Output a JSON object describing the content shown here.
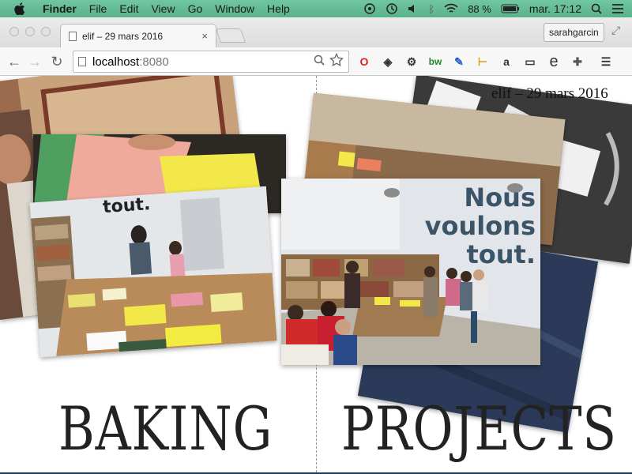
{
  "menubar": {
    "app_name": "Finder",
    "items": [
      "File",
      "Edit",
      "View",
      "Go",
      "Window",
      "Help"
    ],
    "battery": "88 %",
    "clock": "mar. 17:12"
  },
  "browser": {
    "tab_title": "elif – 29 mars 2016",
    "tab_close": "×",
    "profile_name": "sarahgarcin",
    "url_host": "localhost",
    "url_port": ":8080",
    "back_glyph": "←",
    "forward_glyph": "→",
    "reload_glyph": "↻",
    "menu_glyph": "☰",
    "extensions": [
      "O",
      "◈",
      "⚙",
      "bw",
      "✎",
      "⊢",
      "a",
      "▭",
      "e",
      "✚"
    ]
  },
  "page": {
    "doc_title": "elif – 29 mars 2016",
    "word_left": "BAKING",
    "word_right": "PROJECTS",
    "wall_sign": [
      "Nous",
      "voulons",
      "tout."
    ],
    "left_sign_fragment": "tout."
  },
  "colors": {
    "menubar": "#5bb18c",
    "photo_wall": "#e4e8ec",
    "paper_yellow": "#f2e84a",
    "paper_pink": "#f2aaa0",
    "paper_green": "#5fa86a",
    "floor": "#b7b1a6",
    "slate": "#3e3e3e",
    "denim": "#2b3c5a"
  }
}
